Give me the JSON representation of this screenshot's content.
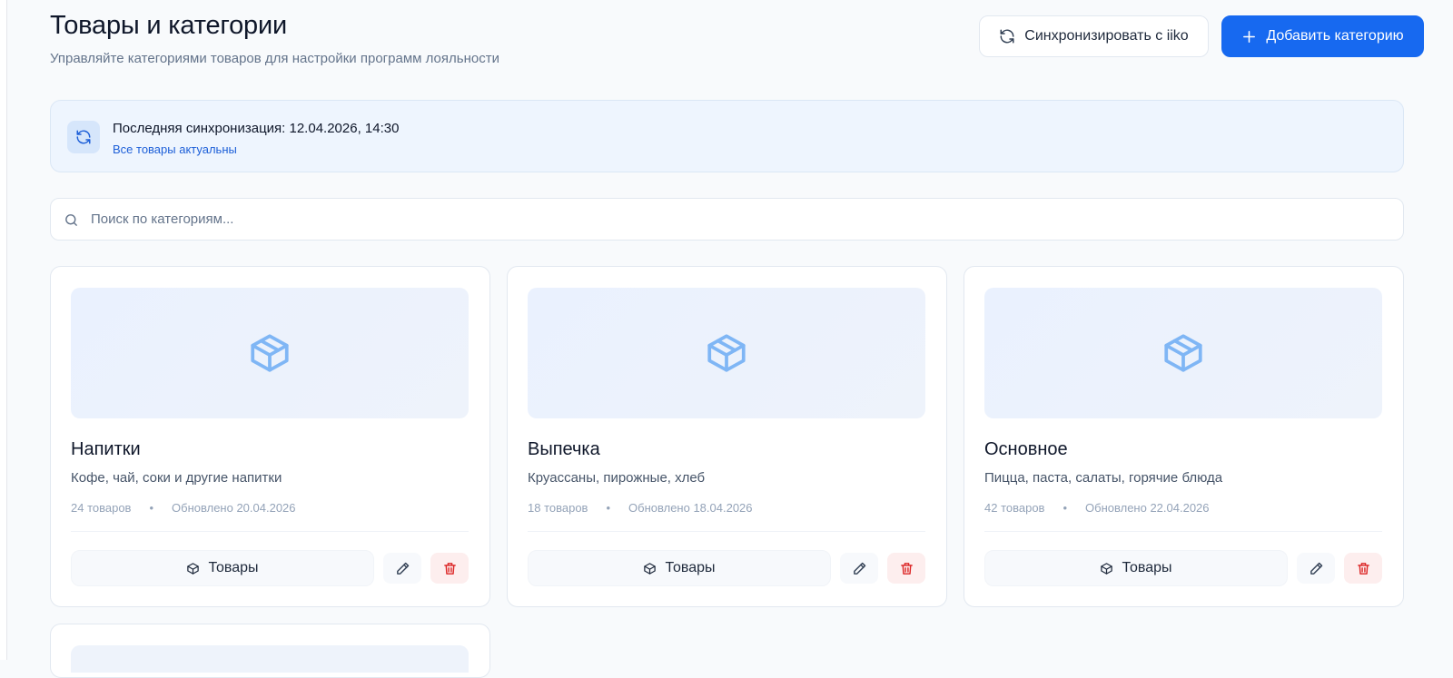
{
  "header": {
    "title": "Товары и категории",
    "subtitle": "Управляйте категориями товаров для настройки программ лояльности",
    "sync_button_label": "Синхронизировать с iiko",
    "add_button_label": "Добавить категорию"
  },
  "sync_banner": {
    "title": "Последняя синхронизация: 12.04.2026, 14:30",
    "status": "Все товары актуальны"
  },
  "search": {
    "placeholder": "Поиск по категориям...",
    "value": ""
  },
  "categories": [
    {
      "name": "Напитки",
      "description": "Кофе, чай, соки и другие напитки",
      "count": "24 товаров",
      "updated": "Обновлено 20.04.2026",
      "products_label": "Товары"
    },
    {
      "name": "Выпечка",
      "description": "Круассаны, пирожные, хлеб",
      "count": "18 товаров",
      "updated": "Обновлено 18.04.2026",
      "products_label": "Товары"
    },
    {
      "name": "Основное",
      "description": "Пицца, паста, салаты, горячие блюда",
      "count": "42 товаров",
      "updated": "Обновлено 22.04.2026",
      "products_label": "Товары"
    }
  ],
  "meta_separator": "•",
  "icons": {
    "sync": "refresh-icon",
    "add": "plus-icon",
    "search": "search-icon",
    "category_image": "package-icon",
    "products": "package-icon",
    "edit": "pencil-icon",
    "delete": "trash-icon"
  },
  "colors": {
    "primary": "#1769f0",
    "banner_bg": "#eef5fe",
    "banner_link": "#1d5fd8",
    "package_icon": "#7fb6f5",
    "delete": "#dc2626",
    "delete_bg": "#fdeeee"
  }
}
